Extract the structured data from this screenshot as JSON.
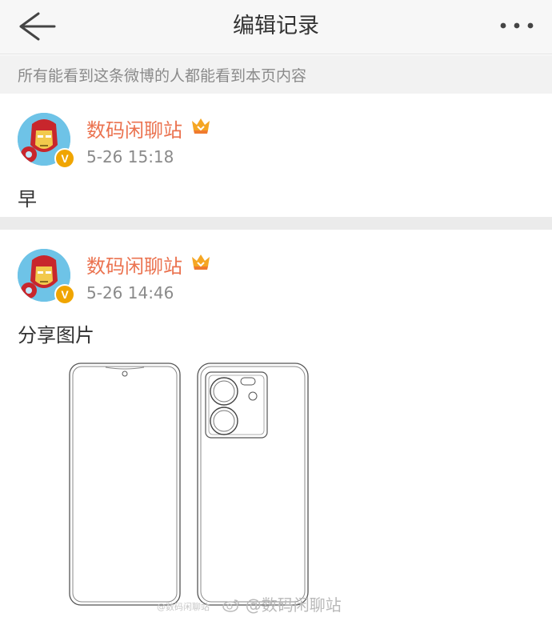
{
  "header": {
    "back_icon": "arrow-left-icon",
    "title": "编辑记录",
    "more_icon": "more-dots-icon"
  },
  "notice": "所有能看到这条微博的人都能看到本页内容",
  "records": [
    {
      "username": "数码闲聊站",
      "time": "5-26 15:18",
      "content": "早",
      "verified_badge": "V"
    },
    {
      "username": "数码闲聊站",
      "time": "5-26 14:46",
      "content": "分享图片",
      "verified_badge": "V",
      "image_icon": "phone-outline-sketch",
      "watermark_small": "@数码闲聊站",
      "watermark": "@数码闲聊站"
    }
  ],
  "colors": {
    "username": "#eb7350",
    "badge": "#f0a500",
    "muted_text": "#8a8a8a"
  }
}
